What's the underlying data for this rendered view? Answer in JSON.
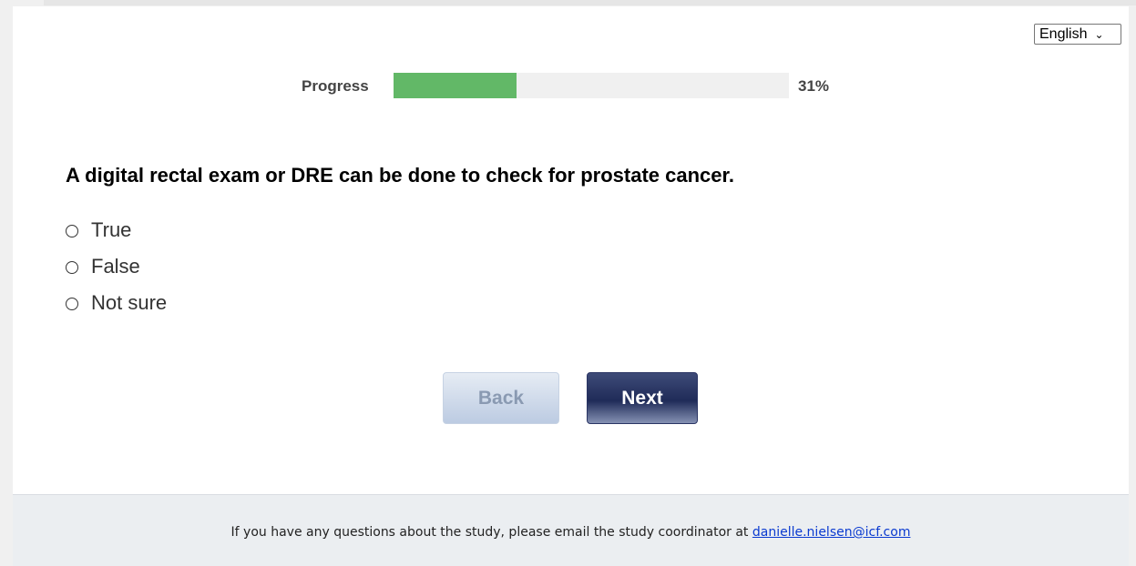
{
  "language": {
    "selected": "English"
  },
  "progress": {
    "label": "Progress",
    "value": 0.31,
    "percent_text": "31%",
    "fill_color": "#62b867"
  },
  "question": {
    "text": "A digital rectal exam or DRE can be done to check for prostate cancer.",
    "options": [
      "True",
      "False",
      "Not sure"
    ]
  },
  "nav": {
    "back_label": "Back",
    "next_label": "Next"
  },
  "footer": {
    "text": "If you have any questions about the study, please email the study coordinator at",
    "email": "danielle.nielsen@icf.com"
  }
}
